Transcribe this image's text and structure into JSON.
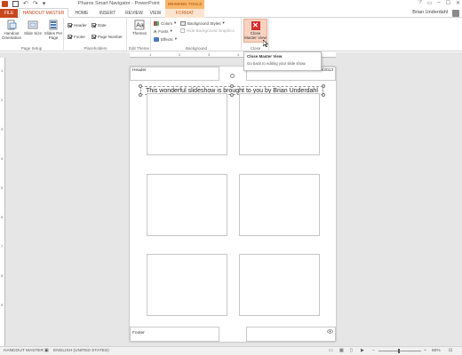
{
  "window": {
    "title": "Pharos Smart Navigator - PowerPoint",
    "contextual_tab_group": "DRAWING TOOLS",
    "controls": [
      "?",
      "▭",
      "–",
      "☐",
      "✕"
    ]
  },
  "tabs": [
    "FILE",
    "HANDOUT MASTER",
    "HOME",
    "INSERT",
    "REVIEW",
    "VIEW",
    "FORMAT"
  ],
  "user": {
    "name": "Brian Underdahl"
  },
  "ribbon": {
    "page_setup": {
      "label": "Page Setup",
      "handout_orientation": "Handout Orientation",
      "slide_size": "Slide Size",
      "slides_per_page": "Slides Per Page"
    },
    "placeholders": {
      "label": "Placeholders",
      "items": [
        {
          "name": "Header",
          "checked": true
        },
        {
          "name": "Date",
          "checked": true
        },
        {
          "name": "Footer",
          "checked": true
        },
        {
          "name": "Page Number",
          "checked": true
        }
      ]
    },
    "edit_theme": {
      "label": "Edit Theme",
      "themes": "Themes"
    },
    "background": {
      "label": "Background",
      "colors": "Colors",
      "fonts": "Fonts",
      "effects": "Effects",
      "background_styles": "Background Styles",
      "hide_background_graphics": "Hide Background Graphics"
    },
    "close": {
      "label": "Close",
      "close_master_view": "Close Master View"
    }
  },
  "tooltip": {
    "title": "Close Master View",
    "description": "Go back to editing your slide show."
  },
  "ruler": {
    "horizontal": [
      "1",
      "2",
      "3",
      "4",
      "5",
      "6"
    ],
    "vertical": [
      "1",
      "2",
      "3",
      "4",
      "5",
      "6",
      "7",
      "8",
      "9"
    ]
  },
  "page": {
    "header": "Header",
    "date": "5/23/2013",
    "textbox": "This wonderful slideshow is brought to you by Brian Underdahl",
    "footer": "Footer",
    "page_number_icon": "eye-icon"
  },
  "statusbar": {
    "view": "HANDOUT MASTER",
    "language": "ENGLISH (UNITED STATES)",
    "zoom": "60%"
  },
  "colors": {
    "accent": "#c8461f",
    "contextual": "#f7b76a",
    "close_icon": "#d32f2f"
  }
}
